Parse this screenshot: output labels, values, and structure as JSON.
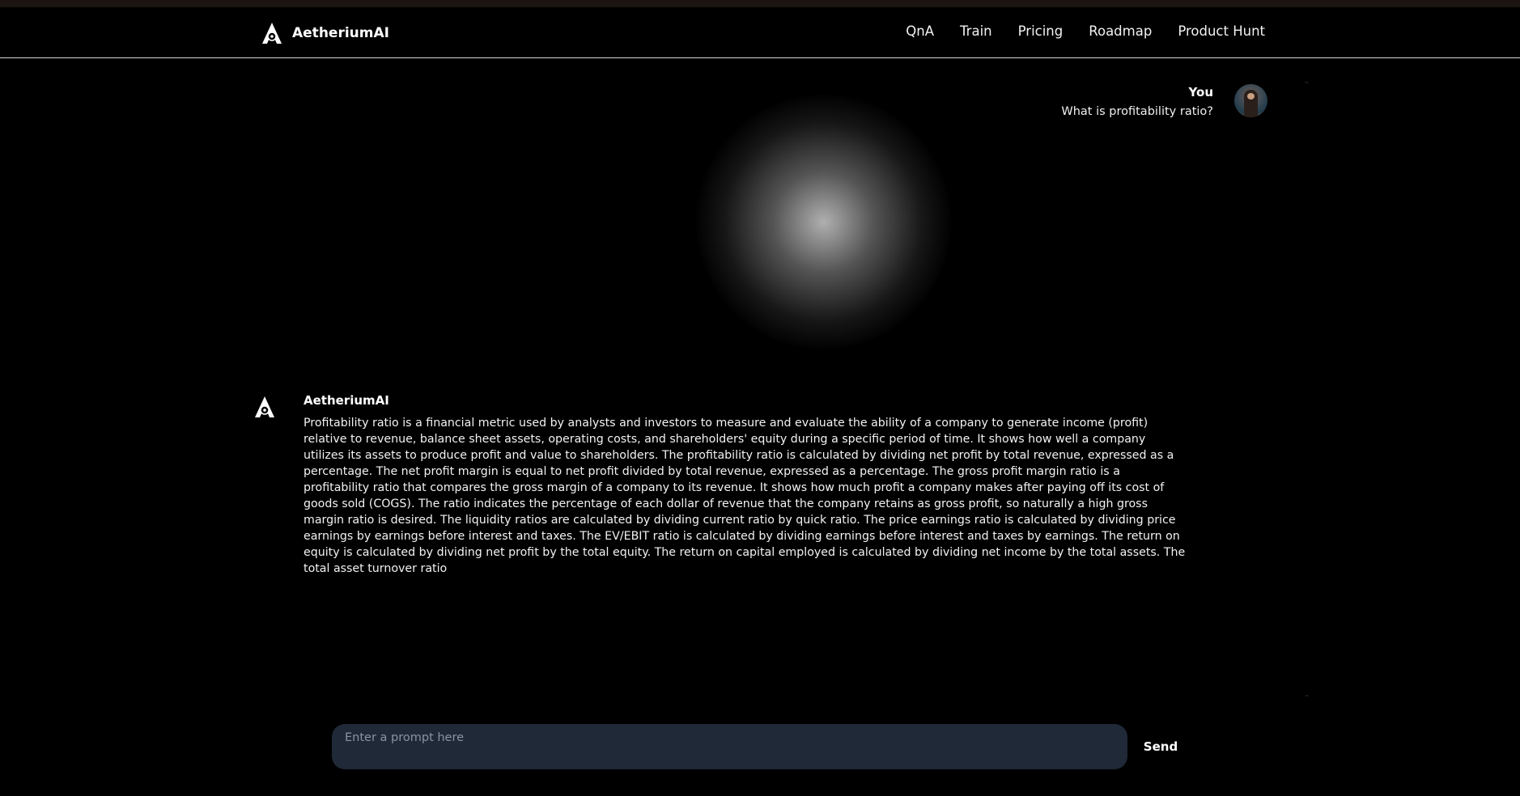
{
  "brand": {
    "name": "AetheriumAI",
    "logo_icon": "aetherium-logo-icon"
  },
  "nav": {
    "links": [
      {
        "label": "QnA"
      },
      {
        "label": "Train"
      },
      {
        "label": "Pricing"
      },
      {
        "label": "Roadmap"
      },
      {
        "label": "Product Hunt"
      }
    ]
  },
  "chat": {
    "user_message": {
      "author": "You",
      "text": "What is profitability ratio?",
      "avatar_icon": "user-avatar"
    },
    "ai_message": {
      "author": "AetheriumAI",
      "text": "Profitability ratio is a financial metric used by analysts and investors to measure and evaluate the ability of a company to generate income (profit) relative to revenue, balance sheet assets, operating costs, and shareholders' equity during a specific period of time. It shows how well a company utilizes its assets to produce profit and value to shareholders. The profitability ratio is calculated by dividing net profit by total revenue, expressed as a percentage. The net profit margin is equal to net profit divided by total revenue, expressed as a percentage. The gross profit margin ratio is a profitability ratio that compares the gross margin of a company to its revenue. It shows how much profit a company makes after paying off its cost of goods sold (COGS). The ratio indicates the percentage of each dollar of revenue that the company retains as gross profit, so naturally a high gross margin ratio is desired. The liquidity ratios are calculated by dividing current ratio by quick ratio. The price earnings ratio is calculated by dividing price earnings by earnings before interest and taxes. The EV/EBIT ratio is calculated by dividing earnings before interest and taxes by earnings. The return on equity is calculated by dividing net profit by the total equity. The return on capital employed is calculated by dividing net income by the total assets. The total asset turnover ratio"
    }
  },
  "composer": {
    "placeholder": "Enter a prompt here",
    "value": "",
    "send_label": "Send"
  },
  "colors": {
    "background": "#000000",
    "input_background": "#1f2937",
    "text": "#ffffff",
    "top_strip": "#1c1410"
  }
}
